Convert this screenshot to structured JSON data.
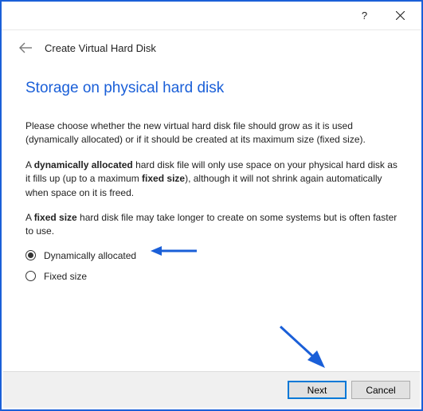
{
  "titlebar": {
    "help": "?",
    "close": "✕"
  },
  "header": {
    "title": "Create Virtual Hard Disk"
  },
  "content": {
    "heading": "Storage on physical hard disk",
    "para1": "Please choose whether the new virtual hard disk file should grow as it is used (dynamically allocated) or if it should be created at its maximum size (fixed size).",
    "para2_pre": "A ",
    "para2_b1": "dynamically allocated",
    "para2_mid": " hard disk file will only use space on your physical hard disk as it fills up (up to a maximum ",
    "para2_b2": "fixed size",
    "para2_post": "), although it will not shrink again automatically when space on it is freed.",
    "para3_pre": "A ",
    "para3_b": "fixed size",
    "para3_post": " hard disk file may take longer to create on some systems but is often faster to use."
  },
  "options": {
    "dynamic": "Dynamically allocated",
    "fixed": "Fixed size",
    "selected": "dynamic"
  },
  "footer": {
    "next": "Next",
    "cancel": "Cancel"
  },
  "annotations": {
    "arrow_color": "#1a5fd8"
  }
}
